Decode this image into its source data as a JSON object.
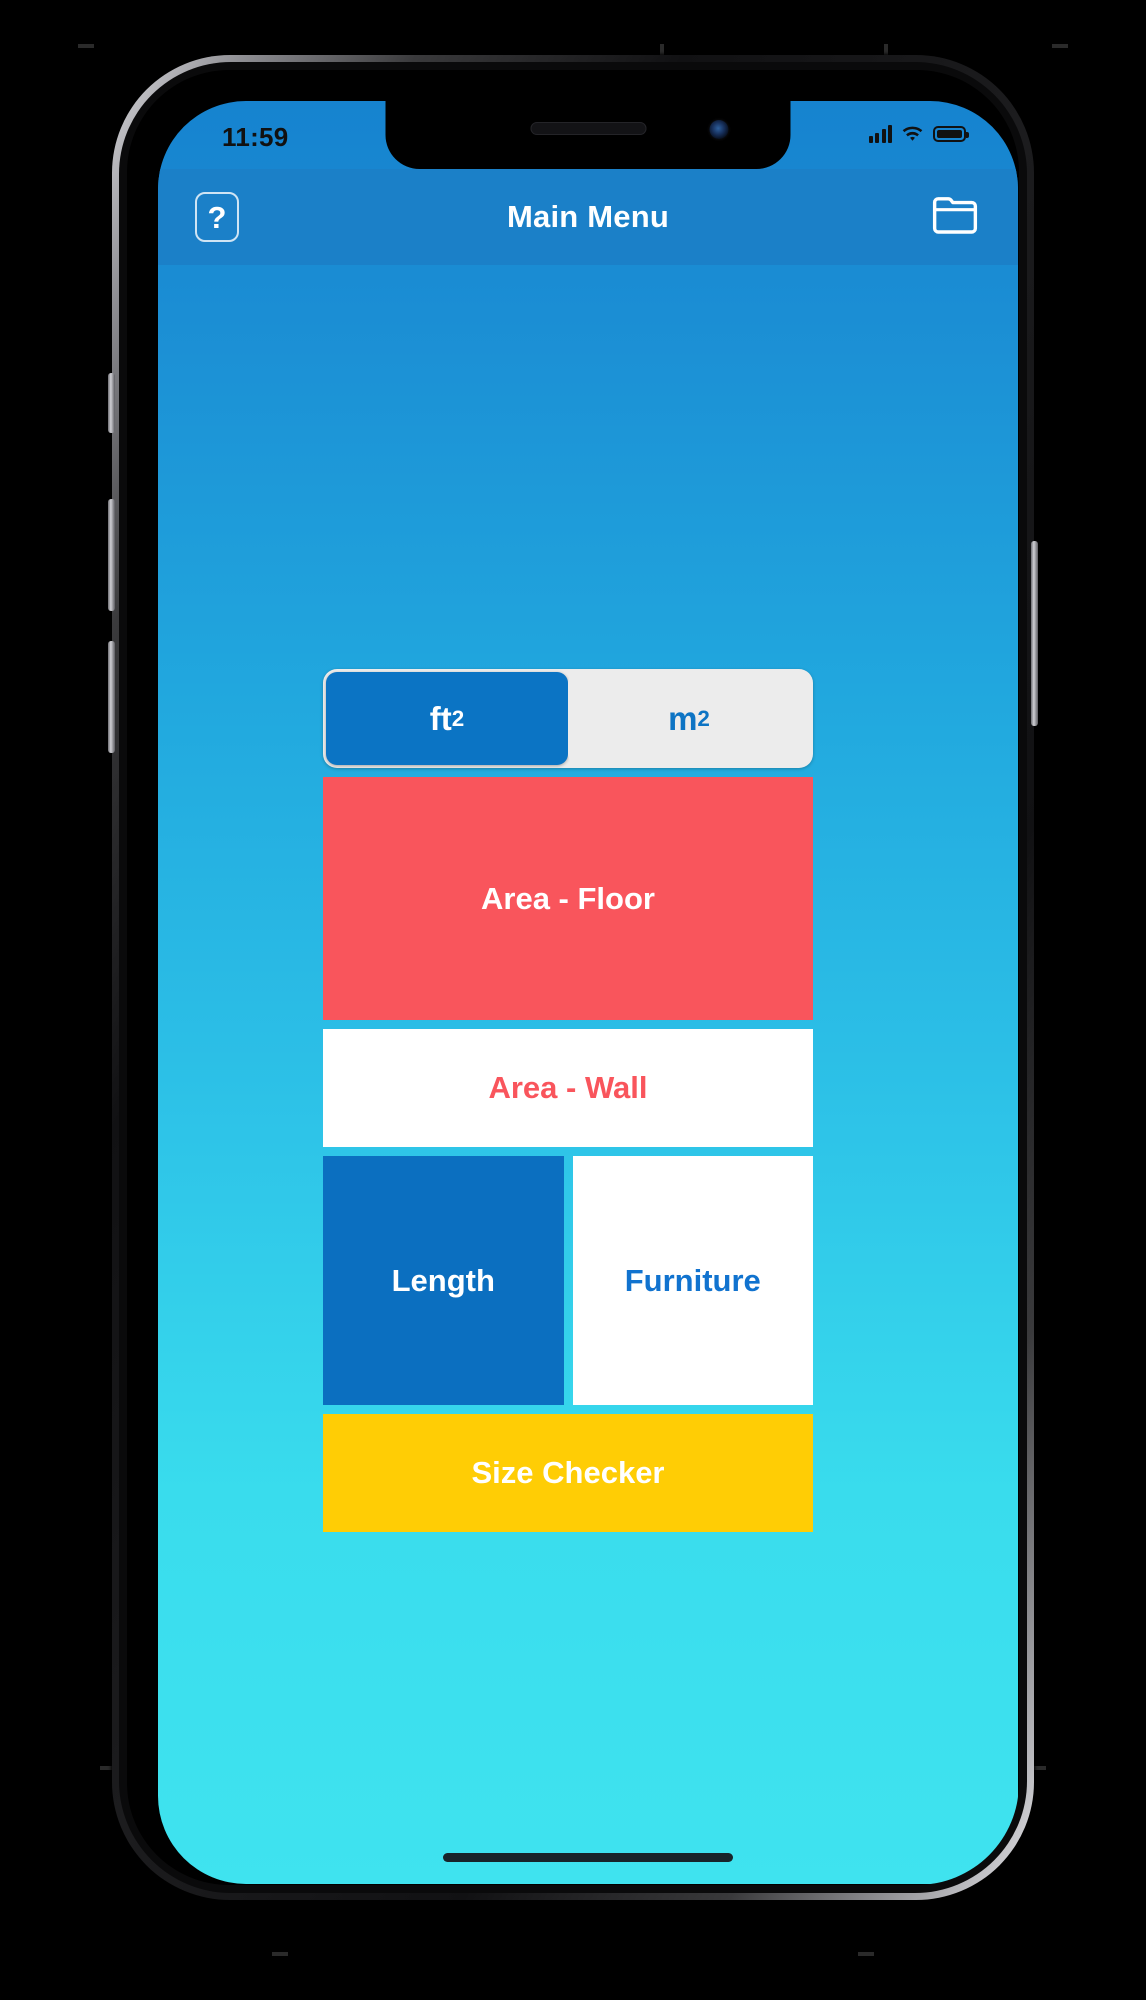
{
  "status_bar": {
    "time": "11:59",
    "icons": [
      "cellular-signal-icon",
      "wifi-icon",
      "battery-icon"
    ],
    "battery_level": "full"
  },
  "nav_bar": {
    "title": "Main Menu",
    "help_label": "?",
    "help_icon": "question-mark-icon",
    "folder_icon": "folder-icon",
    "background_color": "#1b80c8"
  },
  "unit_toggle": {
    "options": [
      {
        "label_base": "ft",
        "label_sup": "2",
        "selected": true
      },
      {
        "label_base": "m",
        "label_sup": "2",
        "selected": false
      }
    ],
    "selected_color": "#0b74c4",
    "track_color": "#ececec"
  },
  "menu": {
    "tiles": [
      {
        "label": "Area - Floor",
        "bg": "#f9555c",
        "fg": "#ffffff"
      },
      {
        "label": "Area - Wall",
        "bg": "#ffffff",
        "fg": "#f9555c"
      },
      {
        "label": "Length",
        "bg": "#0b6fc0",
        "fg": "#ffffff"
      },
      {
        "label": "Furniture",
        "bg": "#ffffff",
        "fg": "#1173cf"
      },
      {
        "label": "Size Checker",
        "bg": "#ffcd05",
        "fg": "#ffffff"
      }
    ]
  },
  "screen": {
    "background_top": "#1683cf",
    "background_bottom": "#3fe3ef"
  }
}
